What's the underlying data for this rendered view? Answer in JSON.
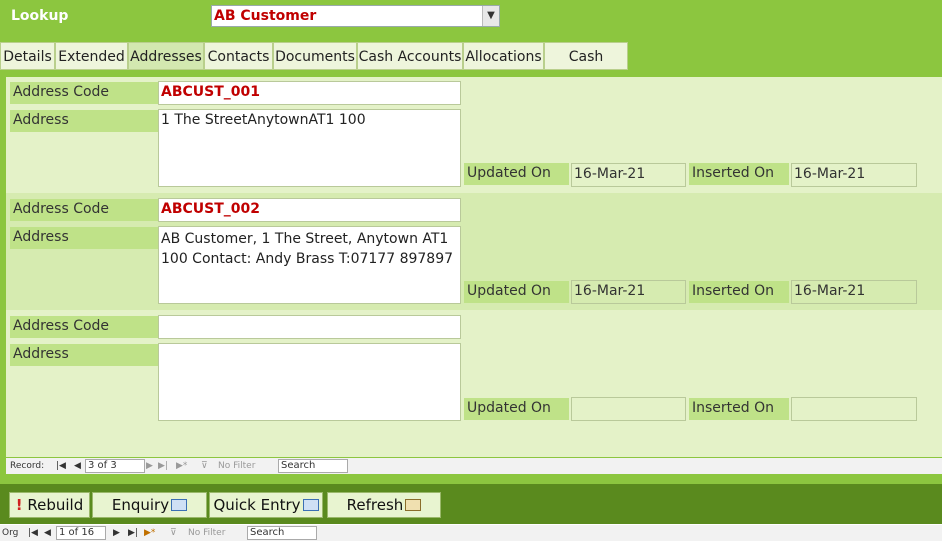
{
  "header": {
    "lookup_label": "Lookup",
    "lookup_value": "AB Customer"
  },
  "tabs": [
    "Details",
    "Extended",
    "Addresses",
    "Contacts",
    "Documents",
    "Cash Accounts",
    "Allocations",
    "Cash Codes"
  ],
  "active_tab": "Addresses",
  "labels": {
    "address_code": "Address Code",
    "address": "Address",
    "updated_on": "Updated On",
    "inserted_on": "Inserted On"
  },
  "records": [
    {
      "address_code": "ABCUST_001",
      "address": "1 The StreetAnytownAT1 100",
      "updated_on": "16-Mar-21",
      "inserted_on": "16-Mar-21"
    },
    {
      "address_code": "ABCUST_002",
      "address": "AB Customer, 1 The Street, Anytown AT1 100 Contact: Andy Brass  T:07177 897897",
      "updated_on": "16-Mar-21",
      "inserted_on": "16-Mar-21"
    },
    {
      "address_code": "",
      "address": "",
      "updated_on": "",
      "inserted_on": ""
    }
  ],
  "subform_nav": {
    "label": "Record:",
    "position": "3 of 3",
    "filter": "No Filter",
    "search": "Search"
  },
  "footer": {
    "rebuild": "Rebuild",
    "enquiry": "Enquiry",
    "quick_entry": "Quick Entry",
    "refresh": "Refresh"
  },
  "main_nav": {
    "label": "Org",
    "position": "1 of 16",
    "filter": "No Filter",
    "search": "Search"
  },
  "colors": {
    "header_green": "#8cc63f",
    "footer_green": "#5a8a1e",
    "code_red": "#c00000"
  }
}
